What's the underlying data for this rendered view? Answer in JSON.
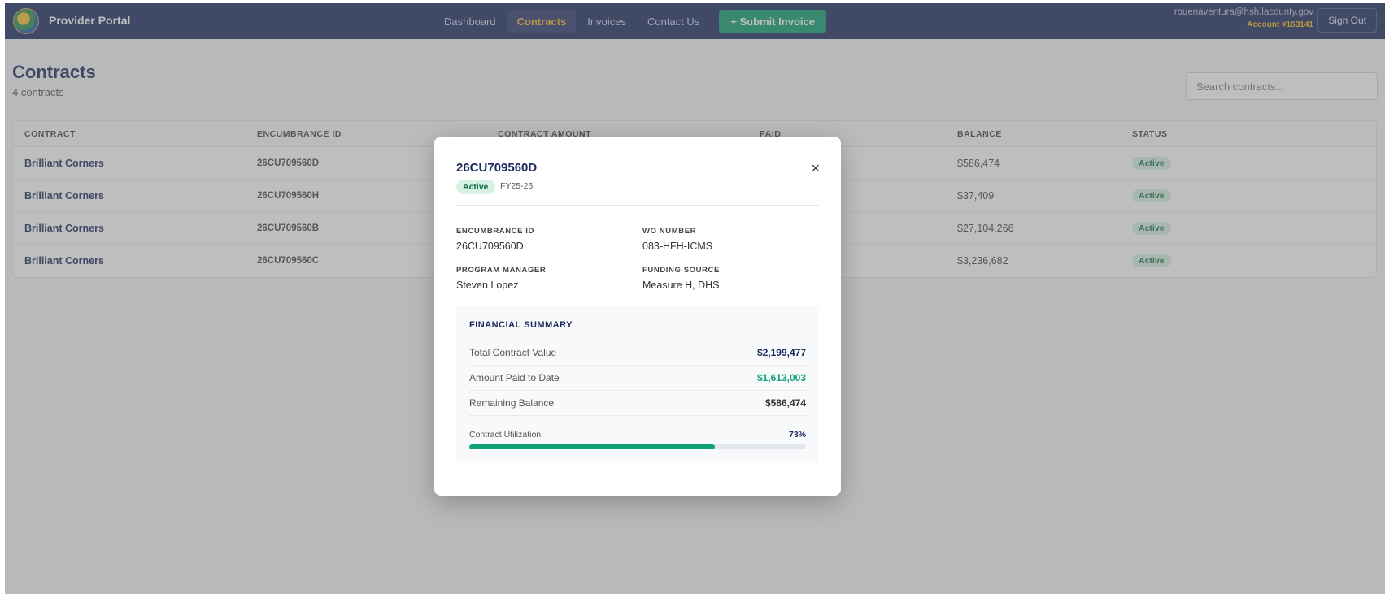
{
  "nav": {
    "brand": "Provider Portal",
    "items": [
      {
        "label": "Dashboard",
        "active": false
      },
      {
        "label": "Contracts",
        "active": true
      },
      {
        "label": "Invoices",
        "active": false
      },
      {
        "label": "Contact Us",
        "active": false
      }
    ],
    "submit_label": "+ Submit Invoice",
    "user_email": "rbuenaventura@hsh.lacounty.gov",
    "account": "Account #163141",
    "signout_label": "Sign Out"
  },
  "page": {
    "title": "Contracts",
    "count": "4 contracts",
    "search_placeholder": "Search contracts..."
  },
  "table": {
    "headers": [
      "CONTRACT",
      "ENCUMBRANCE ID",
      "CONTRACT AMOUNT",
      "PAID",
      "BALANCE",
      "STATUS"
    ],
    "rows": [
      {
        "contract": "Brilliant Corners",
        "encumbrance_id": "26CU709560D",
        "balance": "$586,474",
        "status": "Active"
      },
      {
        "contract": "Brilliant Corners",
        "encumbrance_id": "26CU709560H",
        "balance": "$37,409",
        "status": "Active"
      },
      {
        "contract": "Brilliant Corners",
        "encumbrance_id": "26CU709560B",
        "balance": "$27,104,266",
        "status": "Active"
      },
      {
        "contract": "Brilliant Corners",
        "encumbrance_id": "26CU709560C",
        "balance": "$3,236,682",
        "status": "Active"
      }
    ]
  },
  "modal": {
    "title": "26CU709560D",
    "status": "Active",
    "fiscal_year": "FY25-26",
    "close_glyph": "×",
    "fields": {
      "encumbrance_id_label": "ENCUMBRANCE ID",
      "encumbrance_id": "26CU709560D",
      "wo_number_label": "WO NUMBER",
      "wo_number": "083-HFH-ICMS",
      "program_manager_label": "PROGRAM MANAGER",
      "program_manager": "Steven Lopez",
      "funding_source_label": "FUNDING SOURCE",
      "funding_source": "Measure H, DHS"
    },
    "financial": {
      "title": "FINANCIAL SUMMARY",
      "total_label": "Total Contract Value",
      "total": "$2,199,477",
      "paid_label": "Amount Paid to Date",
      "paid": "$1,613,003",
      "remaining_label": "Remaining Balance",
      "remaining": "$586,474",
      "utilization_label": "Contract Utilization",
      "utilization_text": "73%",
      "utilization_fraction": 0.73
    }
  },
  "colors": {
    "navy": "#1b2a5e",
    "accent_gold": "#f0b429",
    "green": "#0e9f73",
    "paid_green": "#11a27a"
  }
}
